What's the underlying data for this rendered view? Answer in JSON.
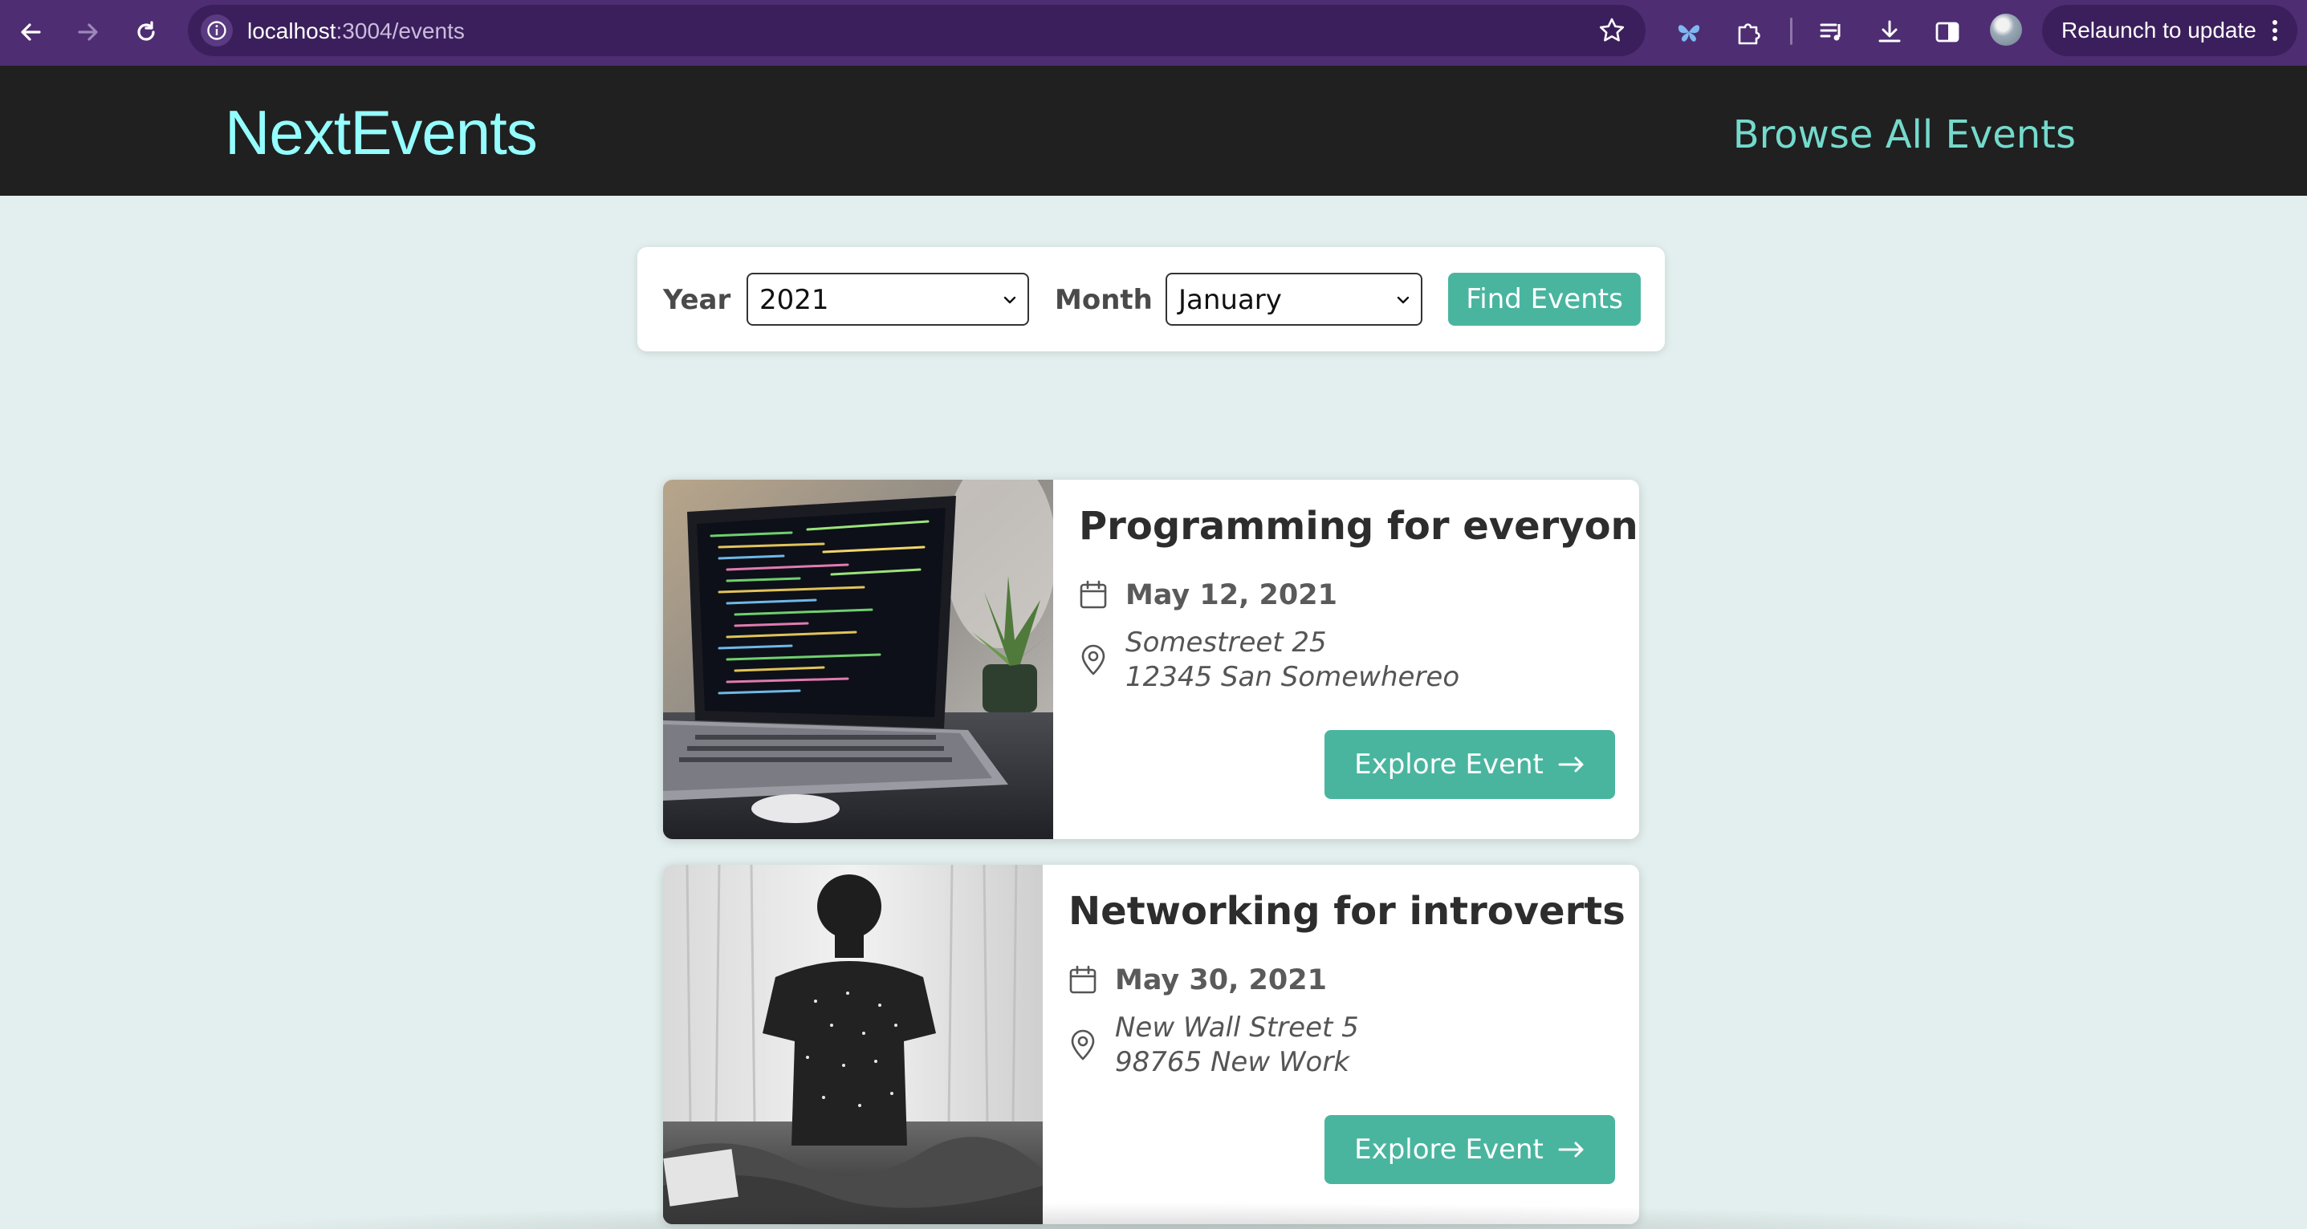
{
  "browser": {
    "url_host": "localhost",
    "url_path": ":3004/events",
    "relaunch_label": "Relaunch to update"
  },
  "header": {
    "logo": "NextEvents",
    "browse_link": "Browse All Events"
  },
  "filter": {
    "year_label": "Year",
    "year_value": "2021",
    "month_label": "Month",
    "month_value": "January",
    "submit_label": "Find Events"
  },
  "events": [
    {
      "title": "Programming for everyone",
      "date": "May 12, 2021",
      "address_line1": "Somestreet 25",
      "address_line2": "12345 San Somewhereo",
      "button_label": "Explore Event",
      "image": "laptop-with-code-photo"
    },
    {
      "title": "Networking for introverts",
      "date": "May 30, 2021",
      "address_line1": "New Wall Street 5",
      "address_line2": "98765 New Work",
      "button_label": "Explore Event",
      "image": "person-sitting-on-bed-photo"
    }
  ],
  "colors": {
    "chrome": "#4e2d73",
    "header_bg": "#202020",
    "logo": "#94fdfd",
    "link": "#74dacc",
    "accent": "#4ab59f",
    "page_bg": "#e3efee"
  }
}
